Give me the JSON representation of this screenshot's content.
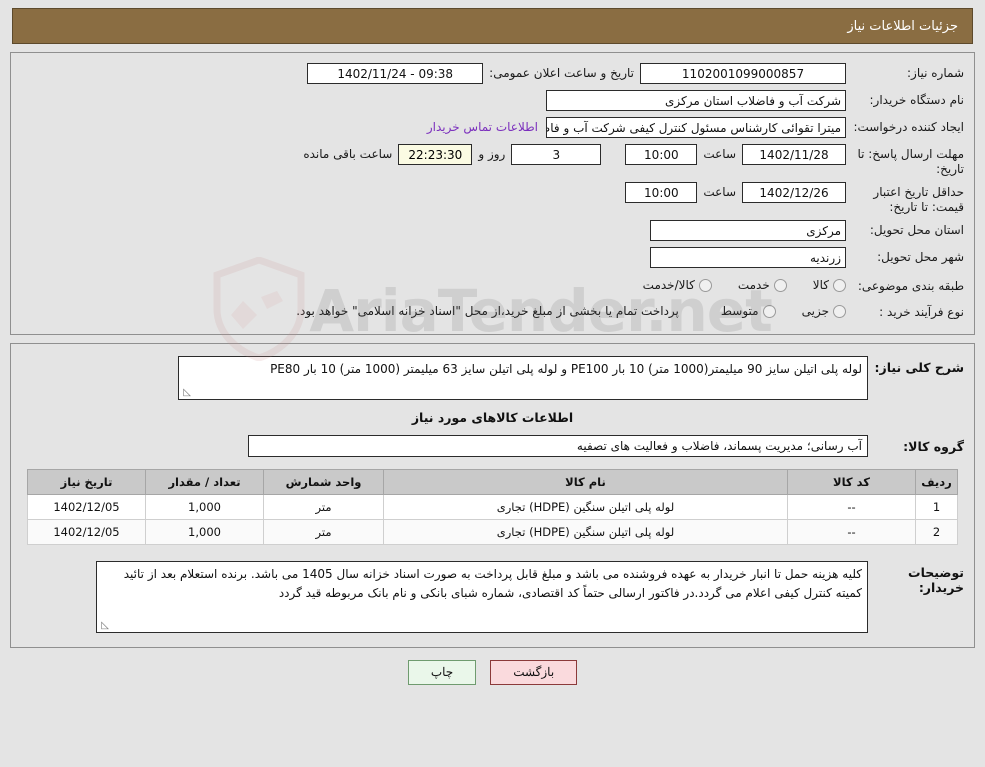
{
  "header": {
    "title": "جزئیات اطلاعات نیاز"
  },
  "top_form": {
    "need_no_label": "شماره نیاز:",
    "need_no_value": "1102001099000857",
    "pub_datetime_label": "تاریخ و ساعت اعلان عمومی:",
    "pub_datetime_value": "09:38 - 1402/11/24",
    "buyer_label": "نام دستگاه خریدار:",
    "buyer_value": "شرکت آب و فاضلاب استان مرکزی",
    "creator_label": "ایجاد کننده درخواست:",
    "creator_value": "میترا تقوائی کارشناس مسئول کنترل کیفی شرکت آب و فاضلاب استان مرکزی",
    "contact_link": "اطلاعات تماس خریدار",
    "deadline_label": "مهلت ارسال پاسخ: تا تاریخ:",
    "deadline_date": "1402/11/28",
    "deadline_time_label": "ساعت",
    "deadline_time": "10:00",
    "remaining_days": "3",
    "remaining_days_label": "روز و",
    "remaining_clock": "22:23:30",
    "remaining_clock_label": "ساعت باقی مانده",
    "price_validity_label": "حداقل تاریخ اعتبار قیمت: تا تاریخ:",
    "price_validity_date": "1402/12/26",
    "price_validity_time_label": "ساعت",
    "price_validity_time": "10:00",
    "province_label": "استان محل تحویل:",
    "province_value": "مرکزی",
    "city_label": "شهر محل تحویل:",
    "city_value": "زرندیه",
    "category_label": "طبقه بندی موضوعی:",
    "category_options": [
      {
        "label": "کالا",
        "checked": false
      },
      {
        "label": "خدمت",
        "checked": false
      },
      {
        "label": "کالا/خدمت",
        "checked": false
      }
    ],
    "process_label": "نوع فرآیند خرید :",
    "process_options": [
      {
        "label": "جزیی",
        "checked": false
      },
      {
        "label": "متوسط",
        "checked": false
      }
    ],
    "process_note": "پرداخت تمام یا بخشی از مبلغ خرید،از محل \"اسناد خزانه اسلامی\" خواهد بود."
  },
  "middle": {
    "need_desc_label": "شرح کلی نیاز:",
    "need_desc_value": "لوله پلی اتیلن سایز 90 میلیمتر(1000 متر) 10 بار PE100 و لوله پلی اتیلن سایز 63 میلیمتر (1000 متر) 10 بار PE80",
    "items_section_title": "اطلاعات کالاهای مورد نیاز",
    "goods_group_label": "گروه کالا:",
    "goods_group_value": "آب رسانی؛ مدیریت پسماند، فاضلاب و فعالیت های تصفیه",
    "table": {
      "columns": [
        "ردیف",
        "کد کالا",
        "نام کالا",
        "واحد شمارش",
        "تعداد / مقدار",
        "تاریخ نیاز"
      ],
      "rows": [
        [
          "1",
          "--",
          "لوله پلی اتیلن سنگین (HDPE) تجاری",
          "متر",
          "1,000",
          "1402/12/05"
        ],
        [
          "2",
          "--",
          "لوله پلی اتیلن سنگین (HDPE) تجاری",
          "متر",
          "1,000",
          "1402/12/05"
        ]
      ]
    },
    "buyer_notes_label": "توضیحات خریدار:",
    "buyer_notes_value": "کلیه هزینه حمل تا انبار خریدار به عهده فروشنده می باشد و مبلغ قابل پرداخت به صورت اسناد خزانه سال 1405 می باشد. برنده استعلام بعد از تائید کمیته کنترل کیفی اعلام می گردد.در فاکتور ارسالی حتماً کد اقتصادی، شماره شبای بانکی و نام بانک مربوطه قید گردد"
  },
  "footer": {
    "print_label": "چاپ",
    "back_label": "بازگشت"
  },
  "watermark": {
    "text": "AriaTender.net"
  },
  "colors": {
    "header_bg": "#8a6d42",
    "link": "#7b2fbd",
    "countdown_bg": "#fbfbe3",
    "back_btn_bg": "#fadadd",
    "print_btn_bg": "#eaf7ea",
    "table_header_bg": "#c9c9c9"
  }
}
